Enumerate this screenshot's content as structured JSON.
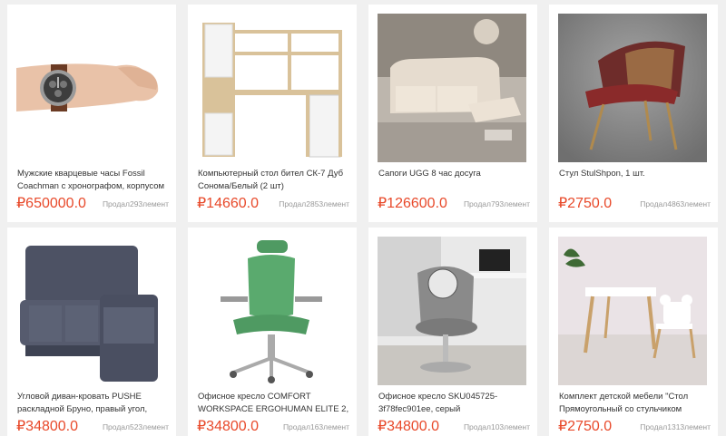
{
  "products": [
    {
      "title": "Мужские кварцевые часы Fossil Coachman с хронографом, корпусом",
      "price": "₽650000.0",
      "sold": "Продал293лемент",
      "icon": "wristwatch"
    },
    {
      "title": "Компьютерный стол бител СК-7 Дуб Сонома/Белый  (2 шт)",
      "price": "₽14660.0",
      "sold": "Продал2853лемент",
      "icon": "computer-desk"
    },
    {
      "title": "Сапоги UGG 8 час досуга",
      "price": "₽126600.0",
      "sold": "Продал793лемент",
      "icon": "recliner-sofa"
    },
    {
      "title": "Стул StulShpon, 1 шт.",
      "price": "₽2750.0",
      "sold": "Продал4863лемент",
      "icon": "armchair"
    },
    {
      "title": "Угловой диван-кровать PUSHE раскладной Бруно, правый угол,",
      "price": "₽34800.0",
      "sold": "Продал523лемент",
      "icon": "corner-sofa"
    },
    {
      "title": "Офисное кресло COMFORT WORKSPACE ERGOHUMAN ELITE 2,",
      "price": "₽34800.0",
      "sold": "Продал163лемент",
      "icon": "office-chair"
    },
    {
      "title": "Офисное кресло SKU045725-3f78fec901ee, серый",
      "price": "₽34800.0",
      "sold": "Продал103лемент",
      "icon": "swivel-chair"
    },
    {
      "title": "Комплект детской мебели \"Стол Прямоугольный со стульчиком",
      "price": "₽2750.0",
      "sold": "Продал1313лемент",
      "icon": "kids-table-set"
    }
  ],
  "colors": {
    "price": "#e8492a",
    "background": "#f0f0f0",
    "card": "#ffffff"
  }
}
